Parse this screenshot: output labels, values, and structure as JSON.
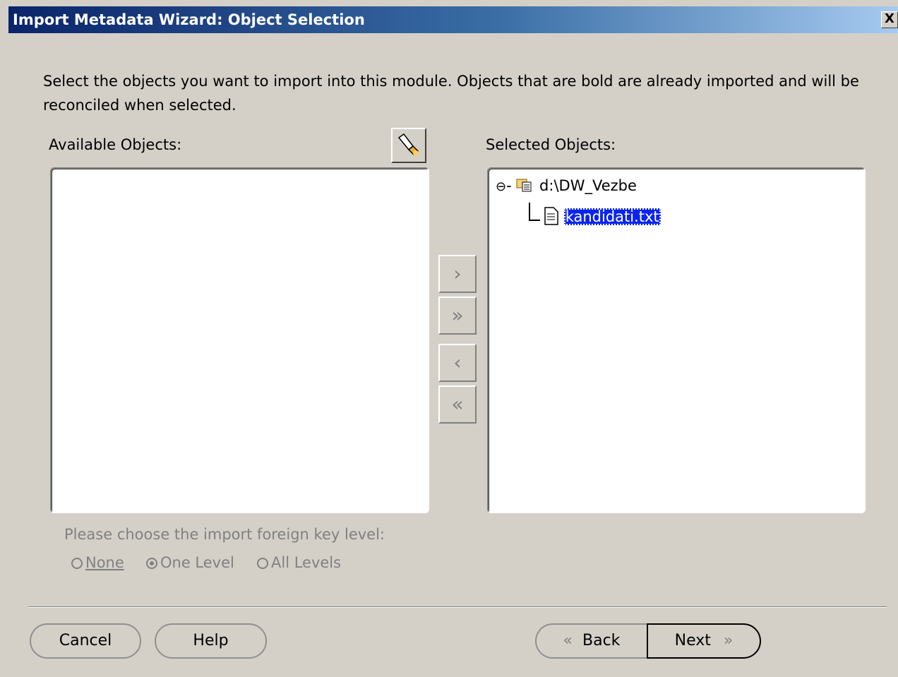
{
  "window": {
    "title": "Import Metadata Wizard: Object Selection",
    "close_glyph": "X"
  },
  "instructions": "Select the objects you want to import into this module. Objects that are bold are already imported and will be reconciled when selected.",
  "available": {
    "label": "Available Objects:",
    "items": []
  },
  "find_button": {
    "icon": "flashlight-icon"
  },
  "selected": {
    "label": "Selected Objects:",
    "tree": {
      "root": {
        "label": "d:\\DW_Vezbe",
        "expander": "⊖",
        "icon": "folder-module-icon"
      },
      "children": [
        {
          "label": "kandidati.txt",
          "icon": "text-file-icon",
          "selected": true
        }
      ]
    }
  },
  "shuttle": {
    "move_one": "›",
    "move_all": "»",
    "remove_one": "‹",
    "remove_all": "«"
  },
  "foreign_key": {
    "prompt": "Please choose the import foreign key level:",
    "options": [
      {
        "label": "None",
        "checked": false
      },
      {
        "label": "One Level",
        "checked": true
      },
      {
        "label": "All Levels",
        "checked": false
      }
    ]
  },
  "buttons": {
    "cancel": "Cancel",
    "help": "Help",
    "back": "Back",
    "next": "Next"
  }
}
